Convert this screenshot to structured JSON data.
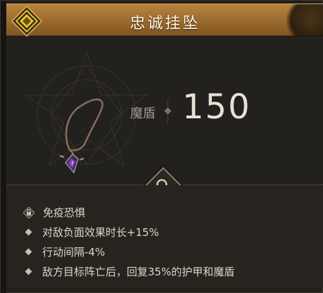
{
  "item": {
    "title": "忠诚挂坠",
    "stat_label": "魔盾",
    "stat_value": "150"
  },
  "effects": [
    {
      "icon": "lock-icon",
      "text": "免疫恐惧"
    },
    {
      "icon": "diamond-bullet-icon",
      "text": "对敌负面效果时长+15%"
    },
    {
      "icon": "diamond-bullet-icon",
      "text": "行动间隔-4%"
    },
    {
      "icon": "diamond-bullet-icon",
      "text": "敌方目标阵亡后，回复35%的护甲和魔盾"
    }
  ],
  "colors": {
    "header_gold": "#b9833f",
    "emblem_yellow": "#e8c233",
    "pendant_purple": "#8a3fc8"
  }
}
